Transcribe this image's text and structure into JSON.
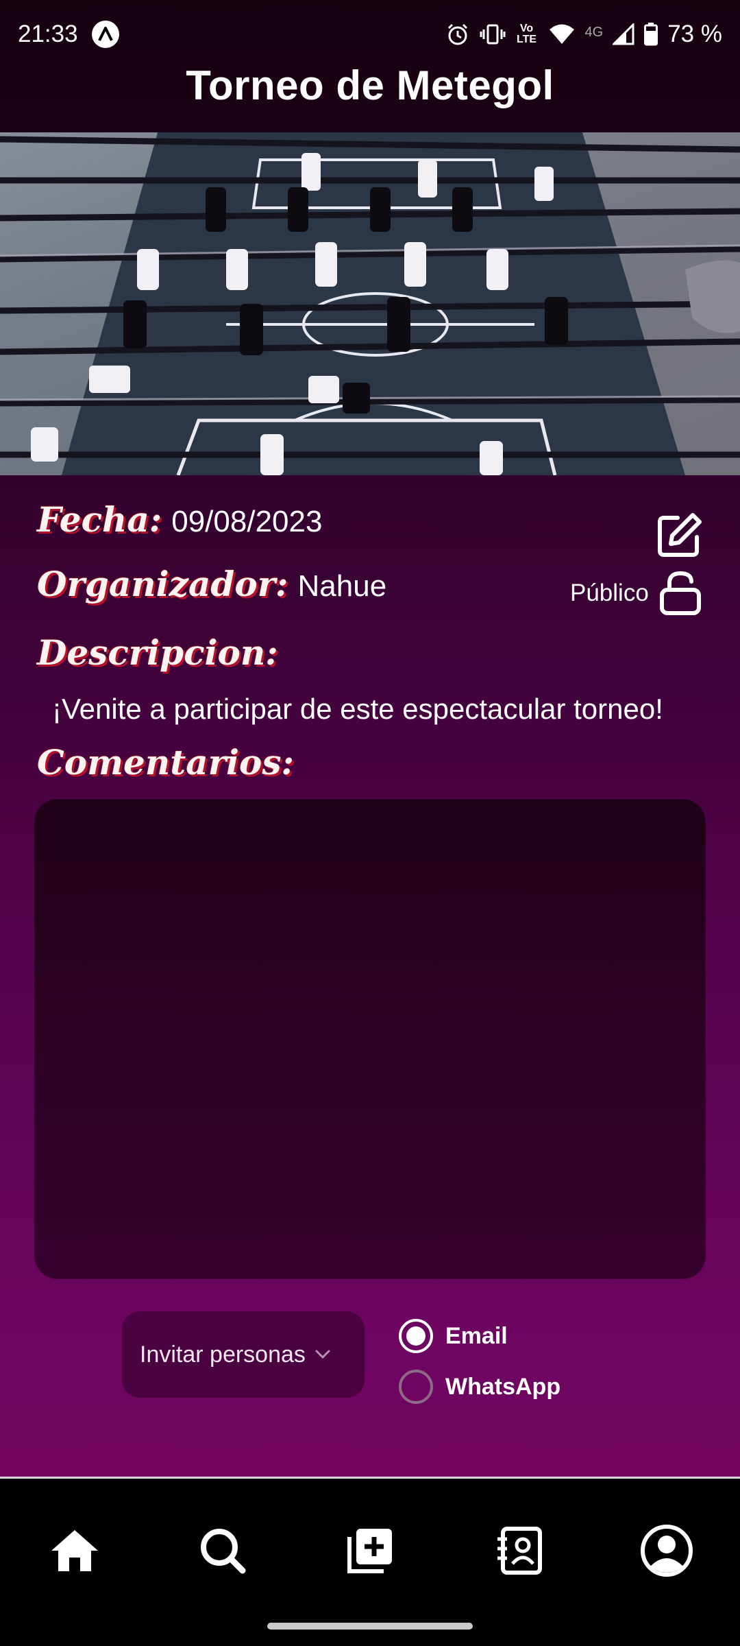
{
  "status_bar": {
    "time": "21:33",
    "battery": "73 %",
    "network": "4G",
    "volte": "Vo LTE",
    "icons": [
      "app-badge-icon",
      "alarm-icon",
      "vibrate-icon",
      "volte-icon",
      "wifi-icon",
      "signal-icon",
      "battery-icon"
    ]
  },
  "header": {
    "title": "Torneo de Metegol"
  },
  "hero": {
    "icon": "foosball-table-photo"
  },
  "details": {
    "fecha_label": "Fecha:",
    "fecha_value": "09/08/2023",
    "organizador_label": "Organizador:",
    "organizador_value": "Nahue",
    "visibility": "Público",
    "descripcion_label": "Descripcion:",
    "descripcion_value": "¡Venite a participar de este espectacular torneo!",
    "comentarios_label": "Comentarios:",
    "comentarios_value": ""
  },
  "invite": {
    "select_label": "Invitar personas",
    "options": [
      {
        "label": "Email",
        "selected": true
      },
      {
        "label": "WhatsApp",
        "selected": false
      }
    ]
  },
  "bottom_nav": {
    "items": [
      {
        "icon": "home-icon"
      },
      {
        "icon": "search-icon"
      },
      {
        "icon": "add-box-icon"
      },
      {
        "icon": "contacts-icon"
      },
      {
        "icon": "profile-icon"
      }
    ]
  },
  "colors": {
    "background_top": "#17010f",
    "background_bottom": "#76055f",
    "label_shadow": "#b3122a"
  }
}
